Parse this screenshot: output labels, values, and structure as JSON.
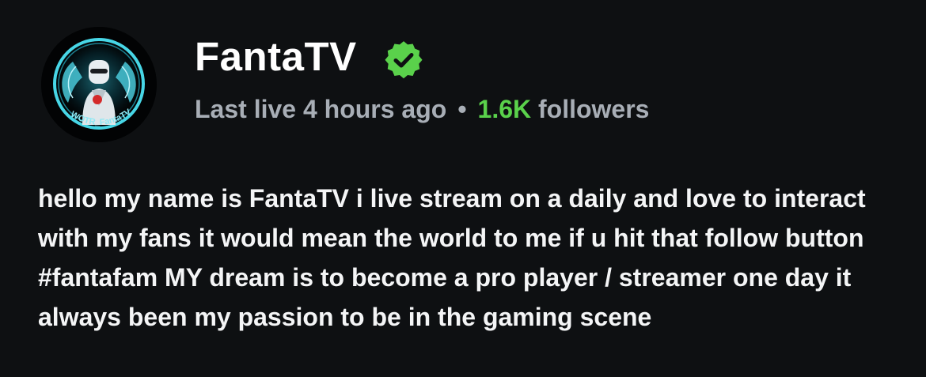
{
  "profile": {
    "avatar_icon": "avatar-logo-icon",
    "avatar_text": "WOTR_FantaTV",
    "name": "FantaTV",
    "verified_icon": "verified-badge-icon",
    "last_live": "Last live 4 hours ago",
    "separator": "•",
    "followers_count": "1.6K",
    "followers_label": " followers",
    "bio": "hello my name is FantaTV i live stream on a daily and love to interact with my fans it would mean the world to me if u hit that follow button #fantafam MY dream is to become a pro player / streamer one day it always been my passion to be in the gaming scene"
  },
  "colors": {
    "background": "#0e1012",
    "accent_green": "#5ad14b",
    "muted_text": "#a8aeb6",
    "text": "#ffffff"
  }
}
